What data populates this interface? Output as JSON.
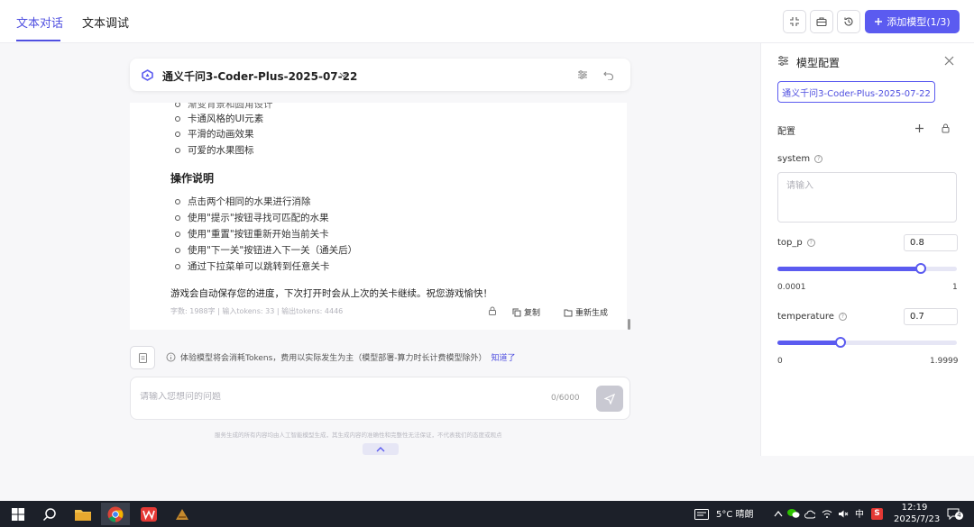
{
  "tabs": [
    {
      "label": "文本对话"
    },
    {
      "label": "文本调试"
    }
  ],
  "toolbar": {
    "add_model_label": "添加模型(1/3)",
    "icons": [
      "compress-icon",
      "toolbox-icon",
      "history-icon"
    ]
  },
  "chat": {
    "model_name": "通义千问3-Coder-Plus-2025-07-22",
    "cut_line": "渐变背景和圆角设计",
    "features": [
      "卡通风格的UI元素",
      "平滑的动画效果",
      "可爱的水果图标"
    ],
    "section_title": "操作说明",
    "steps": [
      "点击两个相同的水果进行消除",
      "使用\"提示\"按钮寻找可匹配的水果",
      "使用\"重置\"按钮重新开始当前关卡",
      "使用\"下一关\"按钮进入下一关（通关后）",
      "通过下拉菜单可以跳转到任意关卡"
    ],
    "paragraph": "游戏会自动保存您的进度，下次打开时会从上次的关卡继续。祝您游戏愉快！",
    "meta": "字数: 1988字 | 输入tokens: 33 | 输出tokens: 4446",
    "copy_label": "复制",
    "regen_label": "重新生成"
  },
  "notice": {
    "text": "体验模型将会消耗Tokens，费用以实际发生为主（模型部署-算力时长计费模型除外）",
    "link": "知道了"
  },
  "input": {
    "placeholder": "请输入您想问的问题",
    "count": "0/6000"
  },
  "disclaimer": "服务生成的所有内容均由人工智能模型生成，其生成内容的准确性和完整性无法保证，不代表我们的态度或观点",
  "panel": {
    "title": "模型配置",
    "model_tag": "通义千问3-Coder-Plus-2025-07-22",
    "config_label": "配置",
    "system_label": "system",
    "system_placeholder": "请输入",
    "top_p": {
      "label": "top_p",
      "value": "0.8",
      "min": "0.0001",
      "max": "1",
      "fraction": 0.8
    },
    "temperature": {
      "label": "temperature",
      "value": "0.7",
      "min": "0",
      "max": "1.9999",
      "fraction": 0.35
    }
  },
  "taskbar": {
    "weather": "5°C 晴朗",
    "ime": "中",
    "time": "12:19",
    "date": "2025/7/23",
    "notif_count": "4"
  },
  "colors": {
    "accent": "#5b5bf0",
    "taskbar": "#1c2029"
  }
}
